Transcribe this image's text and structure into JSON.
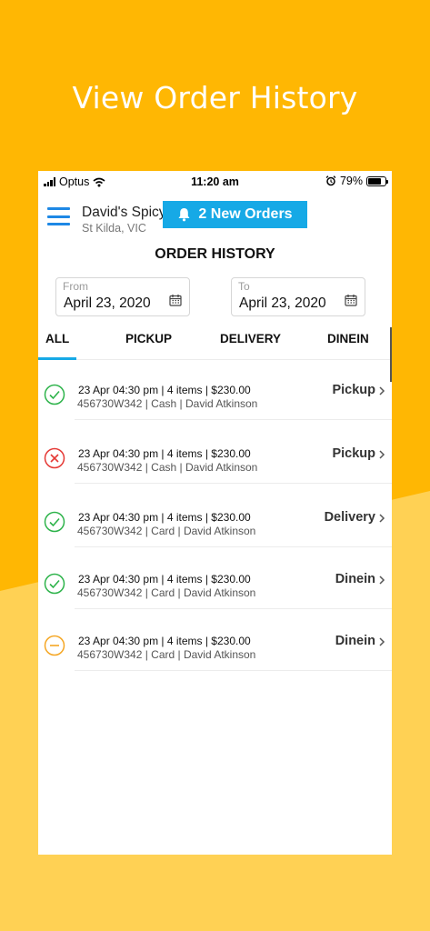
{
  "headline": "View Order History",
  "status_bar": {
    "carrier": "Optus",
    "time": "11:20 am",
    "battery": "79%"
  },
  "header": {
    "store_name": "David's Spicy",
    "store_location": "St Kilda, VIC",
    "new_orders_label": "2 New Orders"
  },
  "page_title": "ORDER HISTORY",
  "filters": {
    "from_label": "From",
    "from_value": "April 23,  2020",
    "to_label": "To",
    "to_value": "April 23,  2020"
  },
  "tabs": [
    {
      "label": "ALL",
      "active": true
    },
    {
      "label": "PICKUP",
      "active": false
    },
    {
      "label": "DELIVERY",
      "active": false
    },
    {
      "label": "DINEIN",
      "active": false
    }
  ],
  "orders": [
    {
      "status": "completed",
      "line1": "23 Apr 04:30 pm | 4 items | $230.00",
      "line2": "456730W342  | Cash  | David Atkinson",
      "type": "Pickup"
    },
    {
      "status": "cancelled",
      "line1": "23 Apr 04:30 pm | 4 items | $230.00",
      "line2": "456730W342  | Cash  | David Atkinson",
      "type": "Pickup"
    },
    {
      "status": "completed",
      "line1": "23 Apr 04:30 pm | 4 items | $230.00",
      "line2": "456730W342  | Card  | David Atkinson",
      "type": "Delivery"
    },
    {
      "status": "completed",
      "line1": "23 Apr 04:30 pm | 4 items | $230.00",
      "line2": "456730W342  | Card  | David Atkinson",
      "type": "Dinein"
    },
    {
      "status": "pending",
      "line1": "23 Apr 04:30 pm | 4 items | $230.00",
      "line2": "456730W342  | Card  | David Atkinson",
      "type": "Dinein"
    }
  ],
  "colors": {
    "background": "#FFB703",
    "accent": "#16A9E6",
    "menu": "#1E88E5",
    "status_completed": "#2DB34A",
    "status_cancelled": "#E53935",
    "status_pending": "#F5A623"
  }
}
